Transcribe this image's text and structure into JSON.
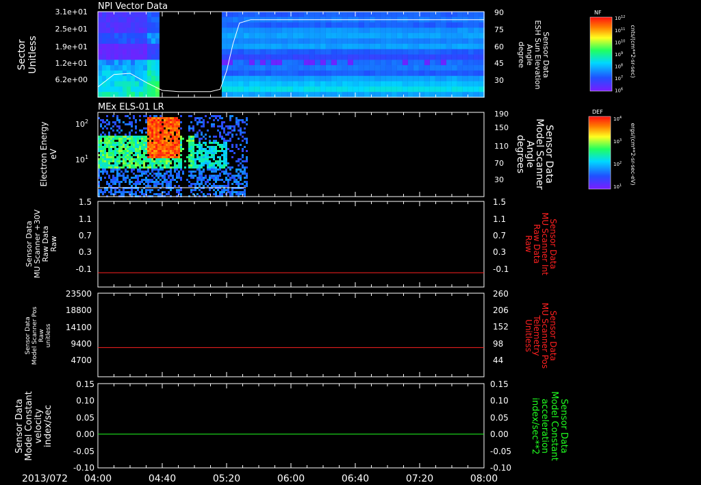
{
  "colors": {
    "background": "#000000",
    "frame": "#ffffff",
    "red": "#ff2020",
    "green": "#20ff20"
  },
  "time_axis": {
    "date": "2013/072",
    "ticks": [
      "04:00",
      "04:40",
      "05:20",
      "06:00",
      "06:40",
      "07:20",
      "08:00"
    ]
  },
  "colorbars": [
    {
      "title": "NF",
      "top_exp": "10",
      "top_sup": "12",
      "labels": [
        [
          "10",
          "11"
        ],
        [
          "10",
          "10"
        ],
        [
          "10",
          "9"
        ],
        [
          "10",
          "8"
        ],
        [
          "10",
          "7"
        ],
        [
          "10",
          "6"
        ]
      ],
      "unit": "cnts/(cm**2-sr-sec)"
    },
    {
      "title": "DEF",
      "labels": [
        [
          "10",
          "4"
        ],
        [
          "10",
          "3"
        ],
        [
          "10",
          "2"
        ],
        [
          "10",
          "1"
        ]
      ],
      "unit": "ergs/(cm**2-sr-sec-eV)"
    }
  ],
  "chart_data": [
    {
      "type": "heatmap",
      "title": "NPI Vector Data",
      "ylabel": [
        "Sector",
        "Unitless"
      ],
      "yticks": [
        "3.1e+01",
        "2.5e+01",
        "1.9e+01",
        "1.2e+01",
        "6.2e+00"
      ],
      "right_ylabel": [
        "Sensor Data",
        "ESH Sun Elevation",
        "Angle",
        "degree"
      ],
      "right_yticks": [
        "90",
        "75",
        "60",
        "45",
        "30"
      ],
      "line_series": {
        "name": "ESH Sun Elevation",
        "x": [
          "04:00",
          "04:10",
          "04:20",
          "04:30",
          "04:40",
          "04:50",
          "05:00",
          "05:10",
          "05:16",
          "05:20",
          "05:24",
          "05:28",
          "05:35",
          "08:00"
        ],
        "y": [
          24,
          35,
          36,
          28,
          21,
          20,
          20,
          20,
          22,
          38,
          62,
          80,
          83,
          83
        ]
      }
    },
    {
      "type": "heatmap",
      "title": "MEx ELS-01 LR",
      "ylabel": [
        "Electron Energy",
        "eV"
      ],
      "yticks": [
        "10",
        "10"
      ],
      "yticks_sup": [
        "2",
        "1"
      ],
      "right_ylabel": [
        "Sensor Data",
        "Model Scanner",
        "Angle",
        "degrees"
      ],
      "right_yticks": [
        "190",
        "150",
        "110",
        "70",
        "30"
      ],
      "line_series": {
        "name": "Model Scanner Angle",
        "x": [
          "04:00",
          "05:32"
        ],
        "y": [
          2,
          2
        ]
      }
    },
    {
      "type": "line",
      "ylabel": [
        "Sensor Data",
        "MU Scanner +30V",
        "Raw Data",
        "Raw"
      ],
      "yticks": [
        "1.5",
        "1.1",
        "0.7",
        "0.3",
        "-0.1"
      ],
      "right_ylabel": [
        "Sensor Data",
        "MU Scanner Int",
        "Raw Data",
        "Raw"
      ],
      "right_yticks": [
        "1.5",
        "1.1",
        "0.7",
        "0.3",
        "-0.1"
      ],
      "series": [
        {
          "color": "#ff2020",
          "x": [
            "04:00",
            "08:00"
          ],
          "y": [
            0,
            0
          ]
        }
      ],
      "ylim": [
        -0.3,
        1.5
      ]
    },
    {
      "type": "line",
      "ylabel": [
        "Sensor Data",
        "Model Scanner Pos",
        "Raw",
        "unitless"
      ],
      "yticks": [
        "23500",
        "18800",
        "14100",
        "9400",
        "4700"
      ],
      "right_ylabel": [
        "Sensor Data",
        "MU Scanner Pos",
        "Telemetry",
        "Unitless"
      ],
      "right_yticks": [
        "260",
        "206",
        "152",
        "98",
        "44"
      ],
      "series": [
        {
          "color": "#ff2020",
          "x": [
            "04:00",
            "08:00"
          ],
          "y": [
            8200,
            8200
          ]
        }
      ],
      "ylim": [
        0,
        23500
      ]
    },
    {
      "type": "line",
      "ylabel": [
        "Sensor Data",
        "Model Constant",
        "velocity",
        "index/sec"
      ],
      "yticks": [
        "0.15",
        "0.10",
        "0.05",
        "0.00",
        "-0.05",
        "-0.10"
      ],
      "right_ylabel": [
        "Sensor Data",
        "Model Constant",
        "acceleration",
        "index/sec**2"
      ],
      "right_yticks": [
        "0.15",
        "0.10",
        "0.05",
        "0.00",
        "-0.05",
        "-0.10"
      ],
      "series": [
        {
          "color": "#20ff20",
          "x": [
            "04:00",
            "08:00"
          ],
          "y": [
            0,
            0
          ]
        }
      ],
      "ylim": [
        -0.1,
        0.15
      ]
    }
  ]
}
